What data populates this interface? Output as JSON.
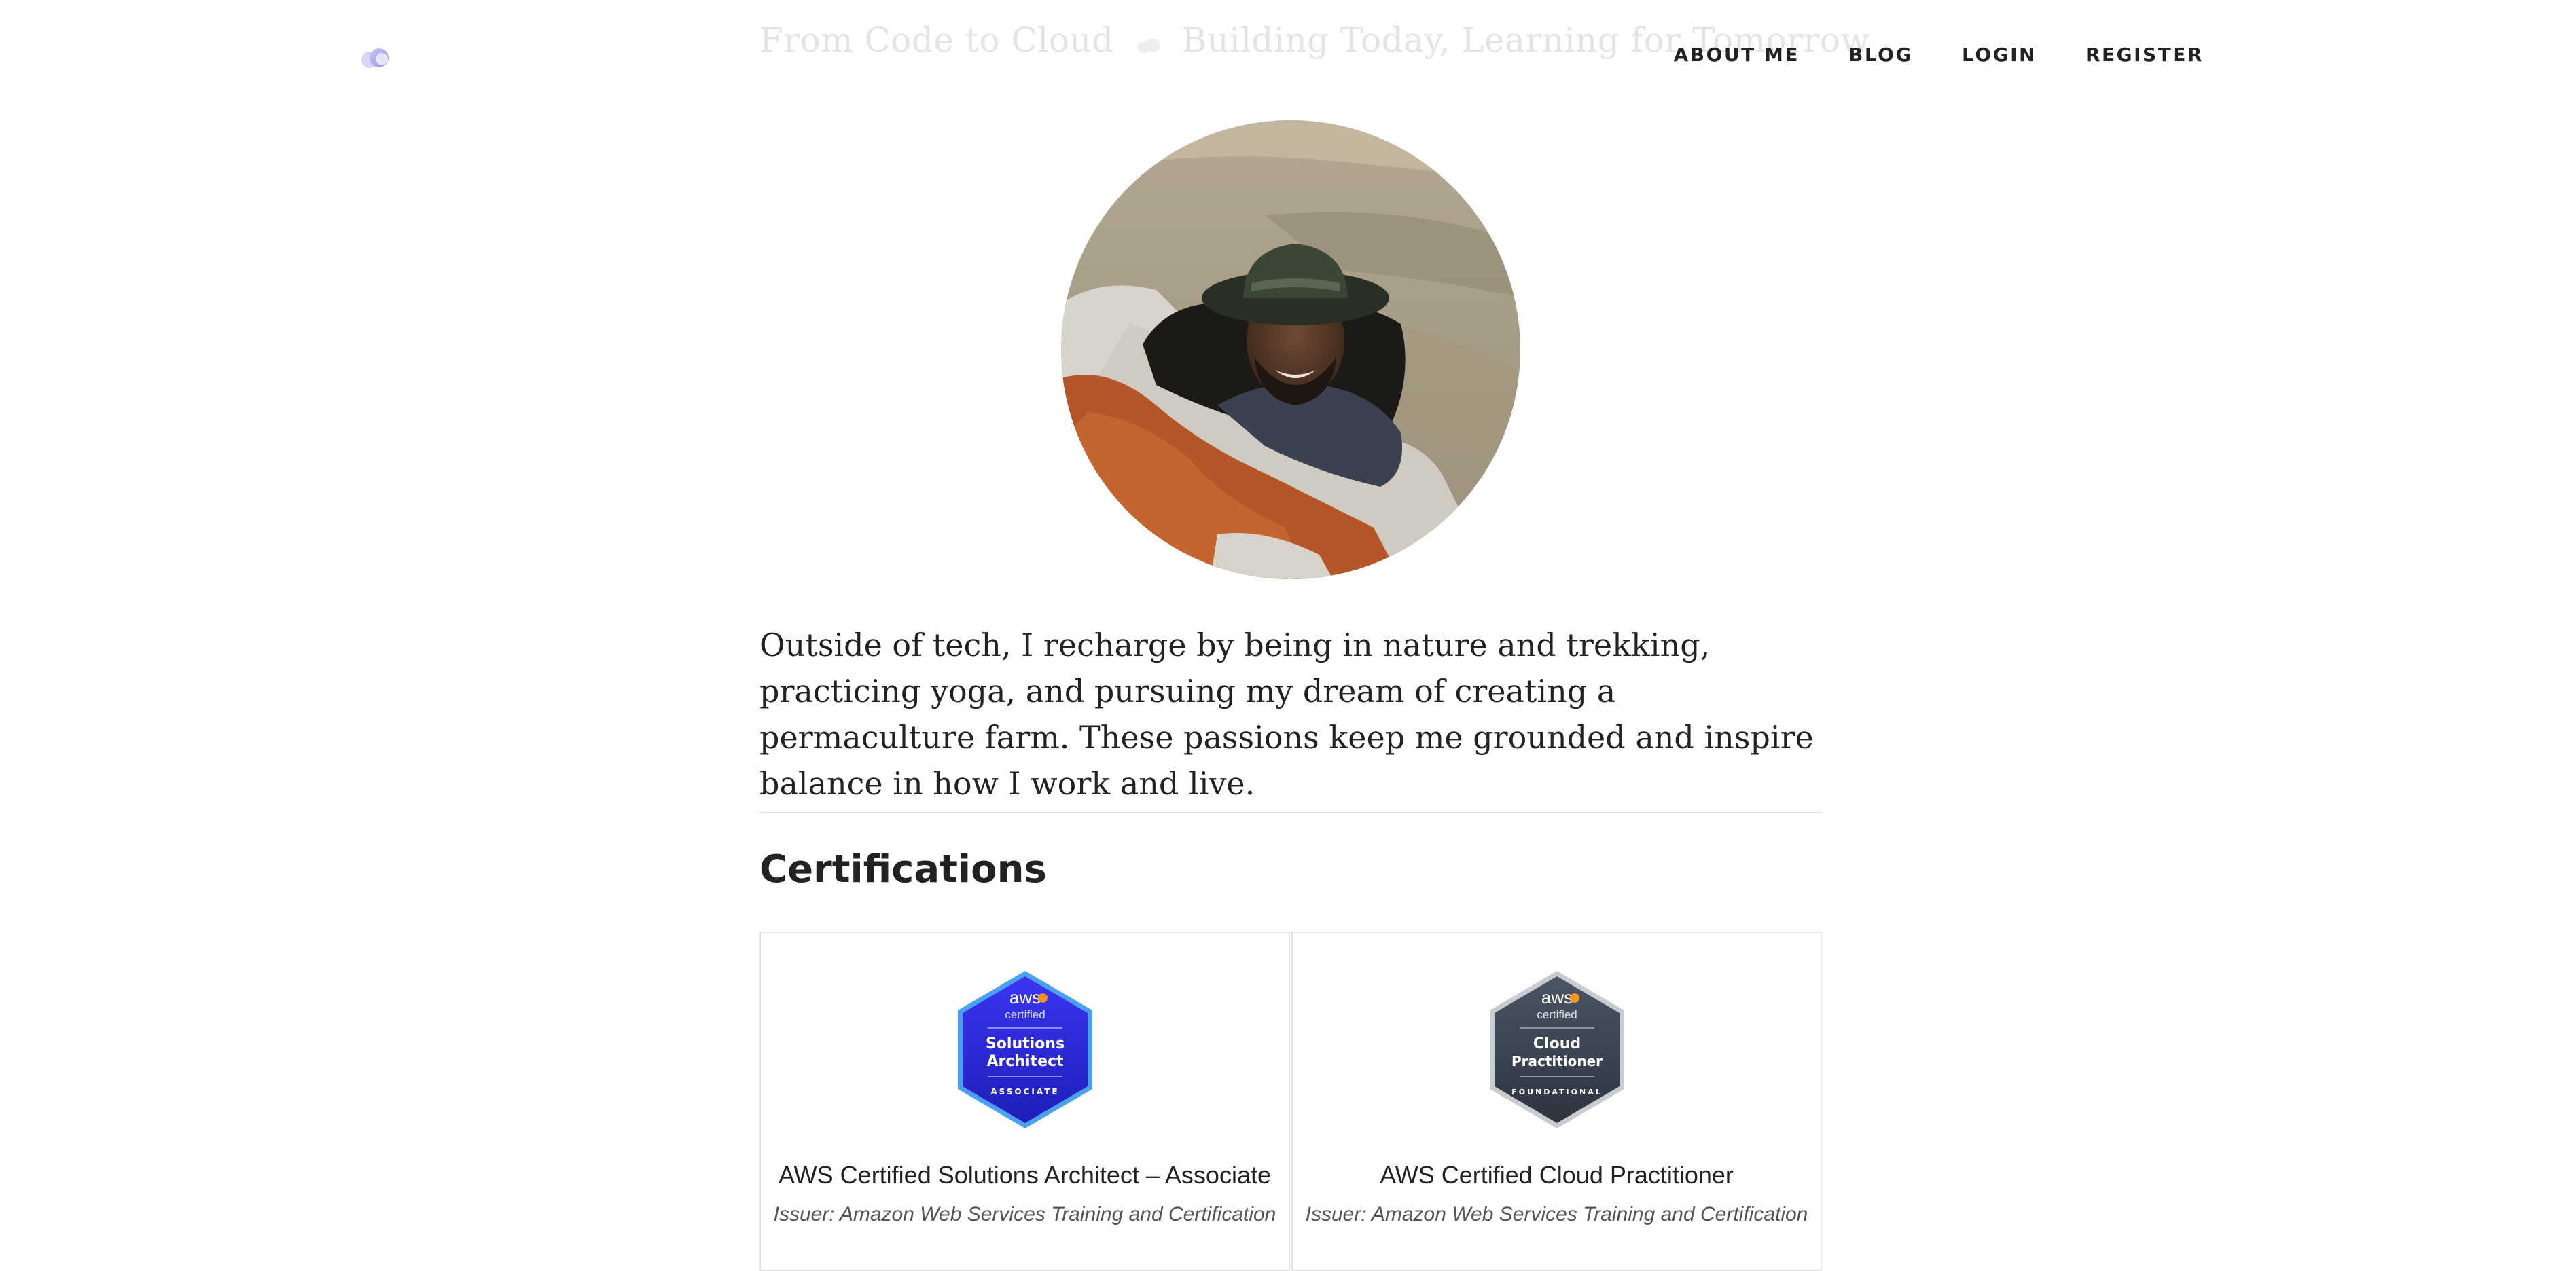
{
  "header": {
    "title_left": "From Code to Cloud",
    "title_separator_icon": "cloud-icon",
    "title_right": "Building Today, Learning for Tomorrow",
    "logo_icon": "cloud-logo-icon"
  },
  "nav": {
    "items": [
      {
        "label": "ABOUT ME"
      },
      {
        "label": "BLOG"
      },
      {
        "label": "LOGIN"
      },
      {
        "label": "REGISTER"
      }
    ]
  },
  "profile": {
    "photo_icon": "profile-photo"
  },
  "bio": {
    "text": "Outside of tech, I recharge by being in nature and trekking, practicing yoga, and pursuing my dream of creating a permaculture farm. These passions keep me grounded and inspire balance in how I work and live."
  },
  "certifications": {
    "heading": "Certifications",
    "items": [
      {
        "name": "AWS Certified Solutions Architect – Associate",
        "issuer": "Issuer: Amazon Web Services Training and Certification",
        "badge": {
          "brand": "aws",
          "certified": "certified",
          "line1": "Solutions",
          "line2": "Architect",
          "level": "ASSOCIATE",
          "color": "#2f2bd9"
        }
      },
      {
        "name": "AWS Certified Cloud Practitioner",
        "issuer": "Issuer: Amazon Web Services Training and Certification",
        "badge": {
          "brand": "aws",
          "certified": "certified",
          "line1": "Cloud",
          "line2": "Practitioner",
          "level": "FOUNDATIONAL",
          "color": "#3c4653"
        }
      }
    ]
  },
  "colors": {
    "text": "#222222",
    "title_faded": "#e4e4e4",
    "divider": "#e2e2e2",
    "aws_orange": "#f7921e"
  }
}
